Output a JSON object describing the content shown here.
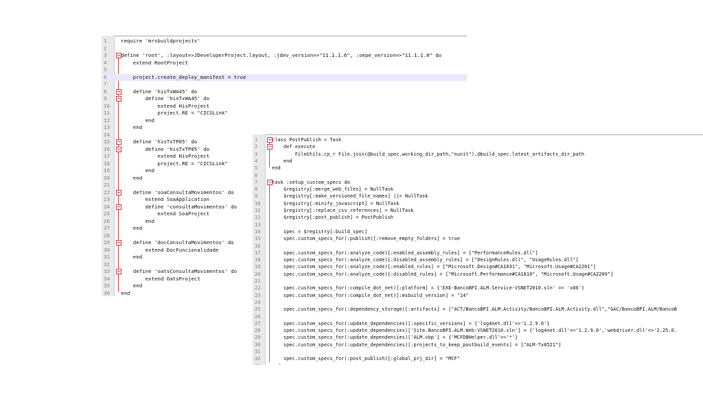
{
  "editor_left": {
    "lines": [
      {
        "n": "1",
        "t": "require 'mrsbuildprojects'"
      },
      {
        "n": "2",
        "t": ""
      },
      {
        "n": "3",
        "t": "define 'root', :layout=>JDeveloperProject.layout, :jdev_version=>\"11.1.1.6\", :oepe_version=>\"11.1.1.8\" do",
        "fold": true
      },
      {
        "n": "4",
        "t": "    extend RootProject"
      },
      {
        "n": "5",
        "t": ""
      },
      {
        "n": "6",
        "t": "    project.create_deploy_manifest = true",
        "hl": true
      },
      {
        "n": "7",
        "t": ""
      },
      {
        "n": "8",
        "t": "    define 'hisTxWA45' do",
        "fold": true
      },
      {
        "n": "9",
        "t": "        define 'hisTxWA45' do",
        "fold": true
      },
      {
        "n": "10",
        "t": "            extend HisProject"
      },
      {
        "n": "11",
        "t": "            project.RE = \"CICSLink\""
      },
      {
        "n": "12",
        "t": "        end"
      },
      {
        "n": "13",
        "t": "    end"
      },
      {
        "n": "14",
        "t": ""
      },
      {
        "n": "15",
        "t": "    define 'hisTxTP05' do",
        "fold": true
      },
      {
        "n": "16",
        "t": "        define 'hisTxTP05' do",
        "fold": true
      },
      {
        "n": "17",
        "t": "            extend HisProject"
      },
      {
        "n": "18",
        "t": "            project.RE = \"CICSLink\""
      },
      {
        "n": "19",
        "t": "        end"
      },
      {
        "n": "20",
        "t": "    end"
      },
      {
        "n": "21",
        "t": ""
      },
      {
        "n": "22",
        "t": "    define 'soaConsultaMovimentos' do",
        "fold": true
      },
      {
        "n": "23",
        "t": "        extend SoaApplication"
      },
      {
        "n": "24",
        "t": "        define 'consultaMovimentos' do",
        "fold": true
      },
      {
        "n": "25",
        "t": "            extend SoaProject"
      },
      {
        "n": "26",
        "t": "        end"
      },
      {
        "n": "27",
        "t": "    end"
      },
      {
        "n": "28",
        "t": ""
      },
      {
        "n": "29",
        "t": "    define 'docConsultaMovimentos' do",
        "fold": true
      },
      {
        "n": "30",
        "t": "        extend DocFuncionalidade"
      },
      {
        "n": "31",
        "t": "    end"
      },
      {
        "n": "32",
        "t": ""
      },
      {
        "n": "33",
        "t": "    define 'oatsConsultaMovimentos' do",
        "fold": true
      },
      {
        "n": "34",
        "t": "        extend OatsProject"
      },
      {
        "n": "35",
        "t": "    end"
      },
      {
        "n": "36",
        "t": "end"
      }
    ]
  },
  "editor_right": {
    "lines": [
      {
        "n": "1",
        "t": "class PostPublish < Task",
        "fold": true
      },
      {
        "n": "2",
        "t": "    def execute",
        "fold": true
      },
      {
        "n": "3",
        "t": "        FileUtils.cp_r File.join(@build_spec.working_dir_path,\"nunit\"),@build_spec.latest_artifacts_dir_path"
      },
      {
        "n": "4",
        "t": "    end"
      },
      {
        "n": "5",
        "t": "end"
      },
      {
        "n": "6",
        "t": ""
      },
      {
        "n": "7",
        "t": "task :setup_custom_specs do",
        "fold": true
      },
      {
        "n": "8",
        "t": "    $registry[:merge_web_files] = NullTask"
      },
      {
        "n": "9",
        "t": "    $registry[:make_versioned_file_names] ||= NullTask"
      },
      {
        "n": "10",
        "t": "    $registry[:minify_javascript] = NullTask"
      },
      {
        "n": "11",
        "t": "    $registry[:replace_css_references] = NullTask"
      },
      {
        "n": "12",
        "t": "    $registry[:post_publish] = PostPublish"
      },
      {
        "n": "13",
        "t": ""
      },
      {
        "n": "14",
        "t": "    spec = $registry[:build_spec]"
      },
      {
        "n": "15",
        "t": "    spec.custom_specs_for(:publish)[:remove_empty_folders] = true"
      },
      {
        "n": "16",
        "t": ""
      },
      {
        "n": "17",
        "t": "    spec.custom_specs_for(:analyze_code)[:enabled_assembly_rules] = [\"PerformanceRules.dll\"]"
      },
      {
        "n": "18",
        "t": "    spec.custom_specs_for(:analyze_code)[:disabled_assembly_rules] = [\"DesignRules.dll\", \"UsageRules.dll\"]"
      },
      {
        "n": "19",
        "t": "    spec.custom_specs_for(:analyze_code)[:enabled_rules] = [\"Microsoft.Design#CA1031\", \"Microsoft.Usage#CA2201\"]"
      },
      {
        "n": "20",
        "t": "    spec.custom_specs_for(:analyze_code)[:disabled_rules] = [\"Microsoft.Performance#CA1810\", \"Microsoft.Usage#CA2209\"]"
      },
      {
        "n": "21",
        "t": ""
      },
      {
        "n": "22",
        "t": "    spec.custom_specs_for(:compile_dot_net)[:platform] = {'EXE-BancoBPI.ALM.Service-VSNET2010.sln' => 'x86'}"
      },
      {
        "n": "23",
        "t": "    spec.custom_specs_for(:compile_dot_net)[:msbuild_version] = \"14\""
      },
      {
        "n": "24",
        "t": ""
      },
      {
        "n": "25",
        "t": "    spec.custom_specs_for(:dependency_storage)[:artifacts] = [\"ACT/BancoBPI.ALM.Activity/BancoBPI.ALM.Activity.dll\",\"GAC/BancoBPI.ALM/BancoB"
      },
      {
        "n": "26",
        "t": ""
      },
      {
        "n": "27",
        "t": "    spec.custom_specs_for(:update_dependencies)[:specific_versions] = {'log4net.dll'=>'1.2.9.0'}"
      },
      {
        "n": "28",
        "t": "    spec.custom_specs_for(:update_dependencies)['Site.BancoBPI.ALM.Web-VSNET2010.sln'] = {'log4net.dll'=>'1.2.9.0','webdriver.dll'=>'2.25.0."
      },
      {
        "n": "29",
        "t": "    spec.custom_specs_for(:update_dependencies)['ALM.vbp'] = {'MCFDBHelper.dll'=>'*'}"
      },
      {
        "n": "30",
        "t": "    spec.custom_specs_for(:update_dependencies)[:projects_to_keep_postbuild_events] = [\"ALM-Tx8521\"]"
      },
      {
        "n": "31",
        "t": ""
      },
      {
        "n": "32",
        "t": "    spec.custom_specs_for(:post_publish)[:global_prj_dir] = \"MCF\""
      },
      {
        "n": "33",
        "t": "end"
      }
    ]
  },
  "colors": {
    "gutter": "#e9e9e9",
    "fold_marker": "#c04040",
    "highlight": "#e8e8ff",
    "line_number": "#808080"
  }
}
